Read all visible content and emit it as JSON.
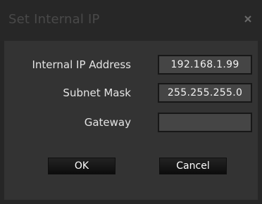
{
  "dialog": {
    "title": "Set Internal IP",
    "close_icon": "close-icon"
  },
  "form": {
    "ip_label": "Internal IP Address",
    "ip_value": "192.168.1.99",
    "subnet_label": "Subnet Mask",
    "subnet_value": "255.255.255.0",
    "gateway_label": "Gateway",
    "gateway_value": ""
  },
  "buttons": {
    "ok_label": "OK",
    "cancel_label": "Cancel"
  }
}
